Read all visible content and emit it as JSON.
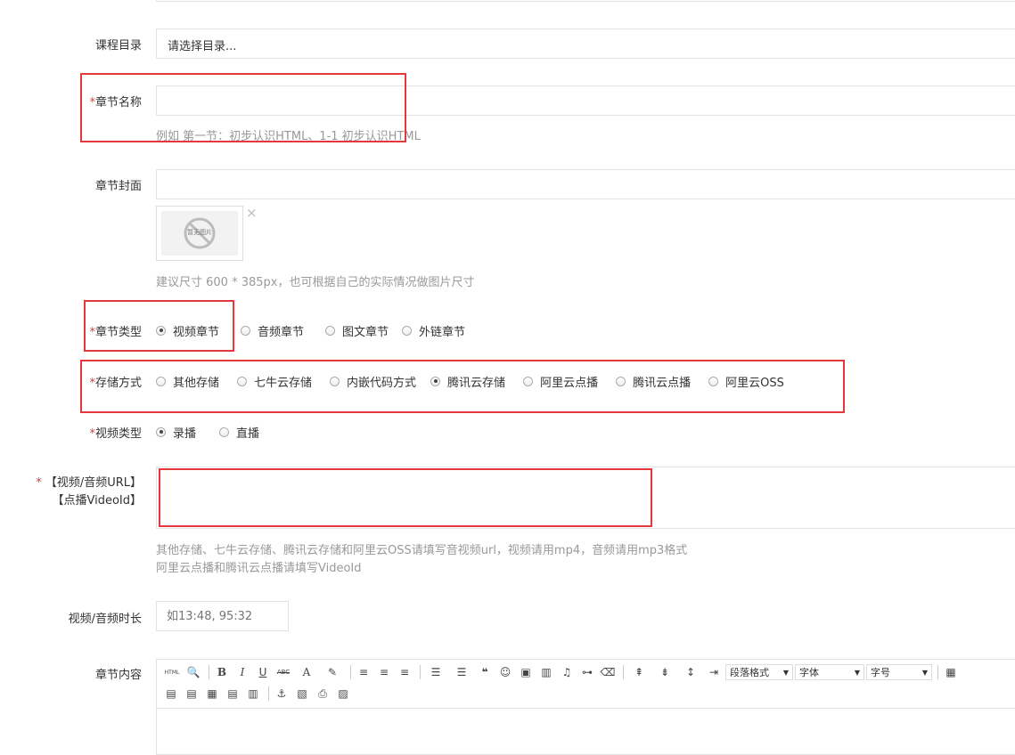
{
  "catalog": {
    "label": "课程目录",
    "value": "请选择目录..."
  },
  "chapter_name": {
    "required": "*",
    "label": "章节名称",
    "value": "",
    "help": "例如 第一节：初步认识HTML、1-1 初步认识HTML"
  },
  "cover": {
    "label": "章节封面",
    "value": "",
    "thumb_text": "暂无图片",
    "remove_icon": "×",
    "help": "建议尺寸 600 * 385px，也可根据自己的实际情况做图片尺寸"
  },
  "chapter_type": {
    "required": "*",
    "label": "章节类型",
    "options": [
      "视频章节",
      "音频章节",
      "图文章节",
      "外链章节"
    ],
    "selected": "视频章节"
  },
  "storage": {
    "required": "*",
    "label": "存储方式",
    "options": [
      "其他存储",
      "七牛云存储",
      "内嵌代码方式",
      "腾讯云存储",
      "阿里云点播",
      "腾讯云点播",
      "阿里云OSS"
    ],
    "selected": "腾讯云存储"
  },
  "video_type": {
    "required": "*",
    "label": "视频类型",
    "options": [
      "录播",
      "直播"
    ],
    "selected": "录播"
  },
  "url": {
    "required": "*",
    "label_line1": "【视频/音频URL】",
    "label_line2": "【点播VideoId】",
    "value": "",
    "help_line1": "其他存储、七牛云存储、腾讯云存储和阿里云OSS请填写音视频url，视频请用mp4，音频请用mp3格式",
    "help_line2": "阿里云点播和腾讯云点播请填写VideoId"
  },
  "duration": {
    "label": "视频/音频时长",
    "placeholder": "如13:48, 95:32"
  },
  "content": {
    "label": "章节内容",
    "toolbar": {
      "html": "HTML",
      "bold": "B",
      "italic": "I",
      "underline": "U",
      "strike": "ABC",
      "font_color": "A",
      "paragraph": "段落格式",
      "font_family": "字体",
      "font_size": "字号"
    }
  },
  "colors": {
    "required": "#e4393c",
    "highlight_box": "#e4393c",
    "border": "#e2e2e2",
    "help": "#999999"
  }
}
